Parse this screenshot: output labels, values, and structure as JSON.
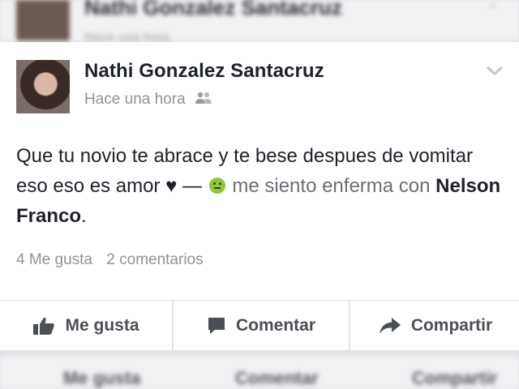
{
  "previous_post": {
    "author": "Nathi Gonzalez Santacruz",
    "time": "Hace una hora"
  },
  "post": {
    "author": "Nathi Gonzalez Santacruz",
    "time": "Hace una hora",
    "audience_icon": "friends-icon",
    "text_main": "Que tu novio te abrace y te bese despues de vomitar eso eso es amor",
    "heart": "♥",
    "dash": "—",
    "feeling_icon": "sick-emoji-icon",
    "feeling_text": "me siento enferma con",
    "tagged_person": "Nelson Franco",
    "period": ".",
    "likes": "4 Me gusta",
    "comments": "2 comentarios"
  },
  "actions": {
    "like": "Me gusta",
    "comment": "Comentar",
    "share": "Compartir"
  },
  "next_actions": {
    "like": "Me gusta",
    "comment": "Comentar",
    "share": "Compartir"
  },
  "colors": {
    "background": "#e3e4e7",
    "card": "#ffffff",
    "text": "#1d2129",
    "muted": "#8f9296",
    "emoji": "#8dc63f"
  }
}
